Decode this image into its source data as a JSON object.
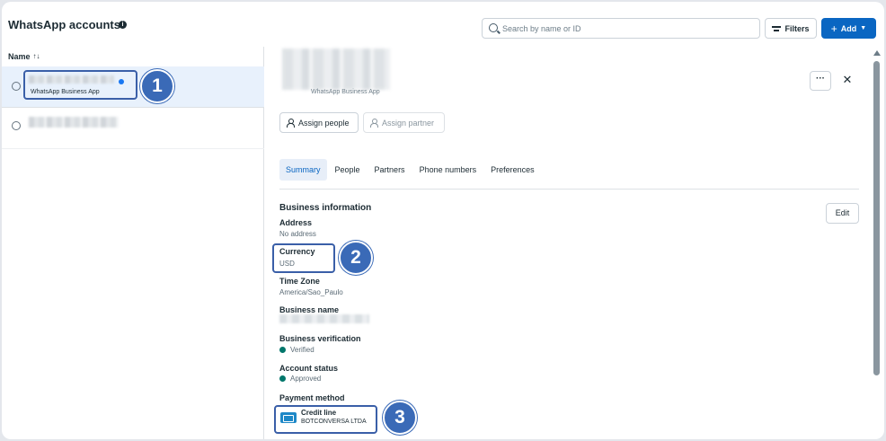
{
  "header": {
    "title": "WhatsApp accounts",
    "search_placeholder": "Search by name or ID",
    "filters_label": "Filters",
    "add_label": "Add"
  },
  "list": {
    "column_header": "Name",
    "rows": [
      {
        "subtitle": "WhatsApp Business App",
        "selected": true
      },
      {
        "subtitle": "",
        "selected": false
      }
    ]
  },
  "detail": {
    "subtitle": "WhatsApp Business App",
    "assign_people": "Assign people",
    "assign_partner": "Assign partner",
    "tabs": [
      "Summary",
      "People",
      "Partners",
      "Phone numbers",
      "Preferences"
    ],
    "active_tab": "Summary",
    "section_title": "Business information",
    "edit_label": "Edit",
    "fields": {
      "address_label": "Address",
      "address_value": "No address",
      "currency_label": "Currency",
      "currency_value": "USD",
      "timezone_label": "Time Zone",
      "timezone_value": "America/Sao_Paulo",
      "business_name_label": "Business name",
      "verification_label": "Business verification",
      "verification_value": "Verified",
      "account_status_label": "Account status",
      "account_status_value": "Approved",
      "payment_label": "Payment method",
      "payment_title": "Credit line",
      "payment_sub": "BOTCONVERSA LTDA"
    }
  },
  "callouts": [
    "1",
    "2",
    "3"
  ],
  "colors": {
    "accent": "#0a66c2",
    "callout": "#3a6ab7",
    "status_green": "#00766b",
    "selected_row": "#e8f1fc"
  }
}
